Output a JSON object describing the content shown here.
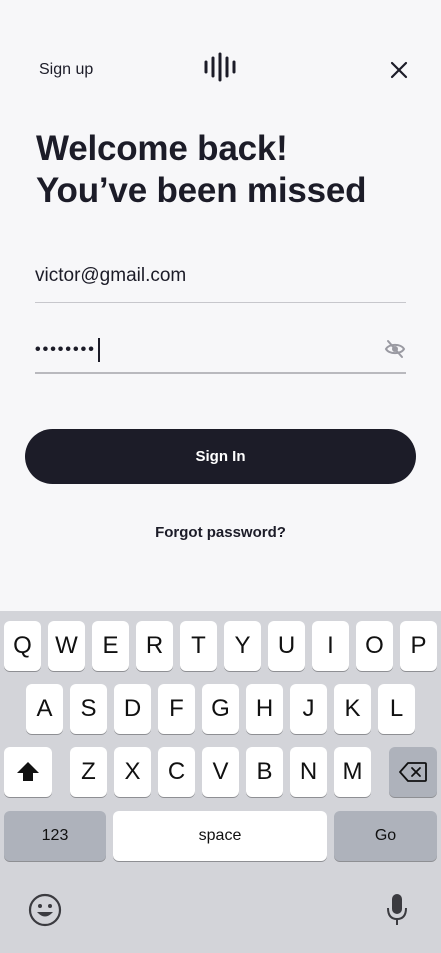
{
  "header": {
    "signup_label": "Sign up",
    "logo_icon": "soundwave-logo-icon",
    "close_icon": "close-icon"
  },
  "heading": {
    "line1": "Welcome back!",
    "line2": "You’ve been missed"
  },
  "form": {
    "email_value": "victor@gmail.com",
    "password_mask": "••••••••",
    "eye_icon": "eye-off-icon",
    "signin_label": "Sign In",
    "forgot_label": "Forgot password?"
  },
  "keyboard": {
    "row1": [
      "Q",
      "W",
      "E",
      "R",
      "T",
      "Y",
      "U",
      "I",
      "O",
      "P"
    ],
    "row2": [
      "A",
      "S",
      "D",
      "F",
      "G",
      "H",
      "J",
      "K",
      "L"
    ],
    "row3": [
      "Z",
      "X",
      "C",
      "V",
      "B",
      "N",
      "M"
    ],
    "shift_icon": "shift-icon",
    "backspace_icon": "backspace-icon",
    "numbers_label": "123",
    "space_label": "space",
    "go_label": "Go",
    "emoji_icon": "emoji-icon",
    "mic_icon": "microphone-icon"
  },
  "colors": {
    "background": "#f7f7f9",
    "primary": "#1c1c28",
    "keyboard_bg": "#d3d4d9",
    "special_key": "#aeb2bb"
  }
}
